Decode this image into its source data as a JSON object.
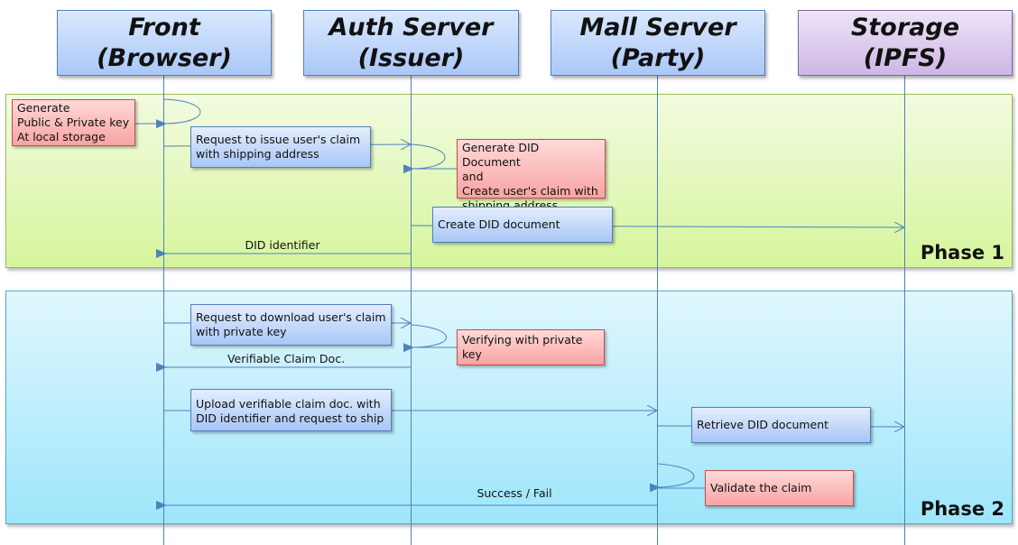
{
  "actors": [
    {
      "line1": "Front",
      "line2": "(Browser)"
    },
    {
      "line1": "Auth Server",
      "line2": "(Issuer)"
    },
    {
      "line1": "Mall Server",
      "line2": "(Party)"
    },
    {
      "line1": "Storage",
      "line2": "(IPFS)"
    }
  ],
  "phases": [
    {
      "label": "Phase 1"
    },
    {
      "label": "Phase 2"
    }
  ],
  "phase1": {
    "gen_keys": [
      "Generate",
      "Public & Private key",
      "At local storage"
    ],
    "request_issue": [
      "Request to issue user's claim",
      "with shipping address"
    ],
    "gen_did": [
      "Generate DID Document",
      "and",
      "Create user's claim with",
      "shipping address"
    ],
    "create_did": "Create DID document",
    "did_identifier": "DID identifier"
  },
  "phase2": {
    "request_download": [
      "Request to download user's claim",
      "with private key"
    ],
    "verifying": "Verifying with private key",
    "verifiable_claim": "Verifiable Claim Doc.",
    "upload": [
      "Upload verifiable claim doc. with",
      "DID identifier and request to ship"
    ],
    "retrieve": "Retrieve DID document",
    "validate": "Validate the claim",
    "success_fail": "Success / Fail"
  },
  "colors": {
    "lifeline": "#4f81bd",
    "phase1_fill": "#d6f59c",
    "phase2_fill": "#9ee6fb",
    "note_blue": "#a8c6f6",
    "note_red": "#f8a3a3",
    "storage_purple": "#cdb7e6"
  }
}
